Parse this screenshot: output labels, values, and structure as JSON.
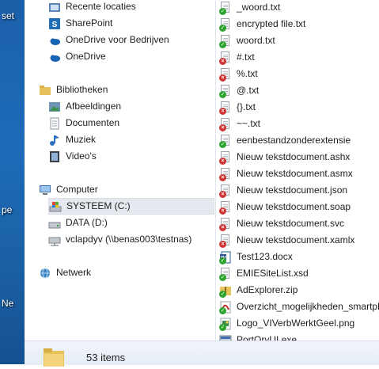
{
  "desktop": {
    "labels": [
      "set",
      "pe",
      "Ne"
    ]
  },
  "nav": {
    "favorites": [
      {
        "label": "Recente locaties",
        "icon": "recent-places-icon"
      },
      {
        "label": "SharePoint",
        "icon": "sharepoint-icon"
      },
      {
        "label": "OneDrive voor Bedrijven",
        "icon": "onedrive-business-icon"
      },
      {
        "label": "OneDrive",
        "icon": "onedrive-icon"
      }
    ],
    "libraries": {
      "label": "Bibliotheken",
      "items": [
        {
          "label": "Afbeeldingen",
          "icon": "pictures-icon"
        },
        {
          "label": "Documenten",
          "icon": "documents-icon"
        },
        {
          "label": "Muziek",
          "icon": "music-icon"
        },
        {
          "label": "Video's",
          "icon": "videos-icon"
        }
      ]
    },
    "computer": {
      "label": "Computer",
      "items": [
        {
          "label": "SYSTEEM (C:)",
          "icon": "system-drive-icon",
          "selected": true
        },
        {
          "label": "DATA (D:)",
          "icon": "drive-icon",
          "selected": false
        },
        {
          "label": "vclapdyv (\\\\benas003\\testnas)",
          "icon": "network-drive-icon",
          "selected": false
        }
      ]
    },
    "network": {
      "label": "Netwerk",
      "icon": "network-icon"
    }
  },
  "files": [
    {
      "name": "_woord.txt",
      "status": "ok"
    },
    {
      "name": "encrypted file.txt",
      "status": "ok"
    },
    {
      "name": "woord.txt",
      "status": "ok"
    },
    {
      "name": "#.txt",
      "status": "err"
    },
    {
      "name": "%.txt",
      "status": "err"
    },
    {
      "name": "@.txt",
      "status": "ok"
    },
    {
      "name": "{}.txt",
      "status": "err"
    },
    {
      "name": "~~.txt",
      "status": "err"
    },
    {
      "name": "eenbestandzonderextensie",
      "status": "ok"
    },
    {
      "name": "Nieuw tekstdocument.ashx",
      "status": "err"
    },
    {
      "name": "Nieuw tekstdocument.asmx",
      "status": "err"
    },
    {
      "name": "Nieuw tekstdocument.json",
      "status": "err"
    },
    {
      "name": "Nieuw tekstdocument.soap",
      "status": "err"
    },
    {
      "name": "Nieuw tekstdocument.svc",
      "status": "err"
    },
    {
      "name": "Nieuw tekstdocument.xamlx",
      "status": "err"
    },
    {
      "name": "Test123.docx",
      "status": "ok",
      "kind": "word"
    },
    {
      "name": "EMIESiteList.xsd",
      "status": "ok"
    },
    {
      "name": "AdExplorer.zip",
      "status": "ok",
      "kind": "zip"
    },
    {
      "name": "Overzicht_mogelijkheden_smartph",
      "status": "ok",
      "kind": "pdf"
    },
    {
      "name": "Logo_VIVerbWerktGeel.png",
      "status": "ok",
      "kind": "image"
    },
    {
      "name": "PortQryUI.exe",
      "status": "ok",
      "kind": "exe"
    }
  ],
  "status": {
    "items_count": "53 items"
  },
  "colors": {
    "ok": "#2ea32e",
    "err": "#d03434",
    "selection": "#e5e9ef"
  }
}
